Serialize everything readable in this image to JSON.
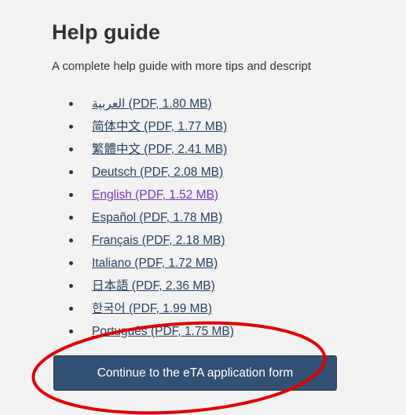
{
  "help_guide": {
    "title": "Help guide",
    "intro": "A complete help guide with more tips and descript",
    "items": [
      {
        "label": "العربية (PDF, 1.80 MB)"
      },
      {
        "label": "简体中文 (PDF, 1.77 MB)"
      },
      {
        "label": "繁體中文 (PDF, 2.41 MB)"
      },
      {
        "label": "Deutsch (PDF, 2.08 MB)"
      },
      {
        "label": "English (PDF, 1.52 MB)",
        "visited": true
      },
      {
        "label": "Español (PDF, 1.78 MB)"
      },
      {
        "label": "Français (PDF, 2.18 MB)"
      },
      {
        "label": "Italiano (PDF, 1.72 MB)"
      },
      {
        "label": "日本語 (PDF, 2.36 MB)"
      },
      {
        "label": "한국어 (PDF, 1.99 MB)"
      },
      {
        "label": "Português (PDF, 1.75 MB)"
      }
    ]
  },
  "continue_button": {
    "label": "Continue to the eTA application form"
  },
  "colors": {
    "link": "#284162",
    "visited_link": "#7834bc",
    "button_background": "#335075",
    "highlight": "#e00000"
  }
}
